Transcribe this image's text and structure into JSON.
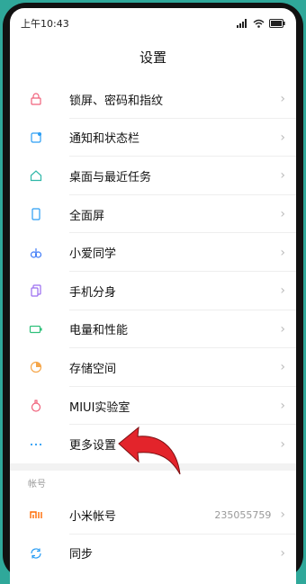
{
  "status": {
    "time": "上午10:43"
  },
  "header": {
    "title": "设置"
  },
  "items": [
    {
      "label": "锁屏、密码和指纹",
      "icon": "lock-icon",
      "color": "#f0607a"
    },
    {
      "label": "通知和状态栏",
      "icon": "notification-icon",
      "color": "#2a9df4"
    },
    {
      "label": "桌面与最近任务",
      "icon": "home-icon",
      "color": "#2fb7a8"
    },
    {
      "label": "全面屏",
      "icon": "fullscreen-icon",
      "color": "#2a9df4"
    },
    {
      "label": "小爱同学",
      "icon": "xiaoai-icon",
      "color": "#3f7bf7"
    },
    {
      "label": "手机分身",
      "icon": "dual-phone-icon",
      "color": "#9a6cf0"
    },
    {
      "label": "电量和性能",
      "icon": "battery-icon",
      "color": "#2fc07a"
    },
    {
      "label": "存储空间",
      "icon": "storage-icon",
      "color": "#f5a64a"
    },
    {
      "label": "MIUI实验室",
      "icon": "lab-flask-icon",
      "color": "#f0607a"
    },
    {
      "label": "更多设置",
      "icon": "more-dots-icon",
      "color": "#2a9df4"
    }
  ],
  "account_section": {
    "title": "帐号",
    "items": [
      {
        "label": "小米帐号",
        "value": "235055759",
        "icon": "mi-account-icon",
        "color": "#ff6a00"
      },
      {
        "label": "同步",
        "icon": "sync-icon",
        "color": "#2a9df4"
      }
    ]
  },
  "chevron": "›"
}
